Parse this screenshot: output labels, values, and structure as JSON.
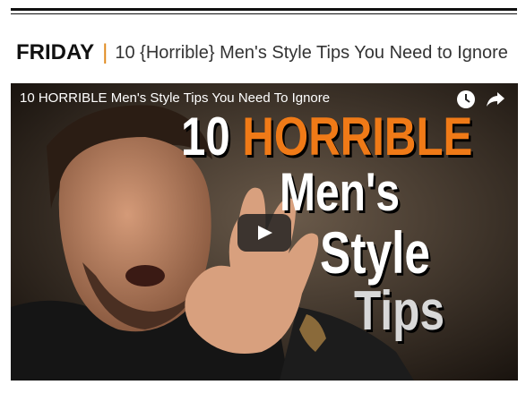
{
  "heading": {
    "day": "FRIDAY",
    "separator": "|",
    "title": "10 {Horrible} Men's Style Tips You Need to Ignore"
  },
  "video": {
    "title": "10 HORRIBLE Men's Style Tips You Need To Ignore",
    "thumbnail": {
      "number": "10",
      "word_horrible": "HORRIBLE",
      "line2": "Men's",
      "line3": "Style",
      "line4": "Tips"
    },
    "icons": [
      "watch-later-icon",
      "share-icon",
      "play-icon"
    ],
    "colors": {
      "accent": "#f07a17",
      "separator": "#e08a1e"
    }
  }
}
